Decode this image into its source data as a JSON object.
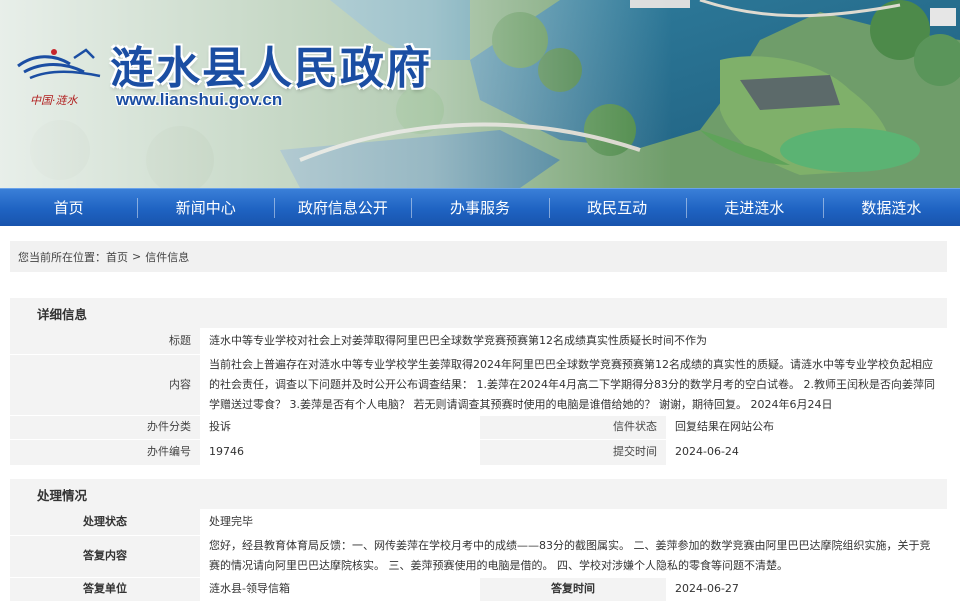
{
  "site": {
    "name": "涟水县人民政府",
    "url": "www.lianshui.gov.cn",
    "emblem_caption": "中国·涟水"
  },
  "nav": [
    {
      "label": "首页"
    },
    {
      "label": "新闻中心"
    },
    {
      "label": "政府信息公开"
    },
    {
      "label": "办事服务"
    },
    {
      "label": "政民互动"
    },
    {
      "label": "走进涟水"
    },
    {
      "label": "数据涟水"
    }
  ],
  "breadcrumb": {
    "prefix": "您当前所在位置：",
    "home": "首页",
    "separator": ">",
    "current": "信件信息"
  },
  "detail": {
    "section_title": "详细信息",
    "title_label": "标题",
    "title_value": "涟水中等专业学校对社会上对姜萍取得阿里巴巴全球数学竞赛预赛第12名成绩真实性质疑长时间不作为",
    "content_label": "内容",
    "content_value": "当前社会上普遍存在对涟水中等专业学校学生姜萍取得2024年阿里巴巴全球数学竞赛预赛第12名成绩的真实性的质疑。请涟水中等专业学校负起相应的社会责任，调查以下问题并及时公开公布调查结果： 1.姜萍在2024年4月高二下学期得分83分的数学月考的空白试卷。 2.教师王闰秋是否向姜萍同学赠送过零食？ 3.姜萍是否有个人电脑？ 若无则请调查其预赛时使用的电脑是谁借给她的？ 谢谢，期待回复。 2024年6月24日",
    "category_label": "办件分类",
    "category_value": "投诉",
    "status_label": "信件状态",
    "status_value": "回复结果在网站公布",
    "number_label": "办件编号",
    "number_value": "19746",
    "submit_time_label": "提交时间",
    "submit_time_value": "2024-06-24"
  },
  "handling": {
    "section_title": "处理情况",
    "state_label": "处理状态",
    "state_value": "处理完毕",
    "reply_label": "答复内容",
    "reply_value": "您好，经县教育体育局反馈：一、网传姜萍在学校月考中的成绩——83分的截图属实。 二、姜萍参加的数学竞赛由阿里巴巴达摩院组织实施，关于竞赛的情况请向阿里巴巴达摩院核实。 三、姜萍预赛使用的电脑是借的。 四、学校对涉嫌个人隐私的零食等问题不清楚。",
    "unit_label": "答复单位",
    "unit_value": "涟水县-领导信箱",
    "reply_time_label": "答复时间",
    "reply_time_value": "2024-06-27"
  },
  "colors": {
    "nav_blue": "#1f63c2",
    "logo_blue": "#1b4ea3",
    "label_bg": "#f3f3f3"
  }
}
